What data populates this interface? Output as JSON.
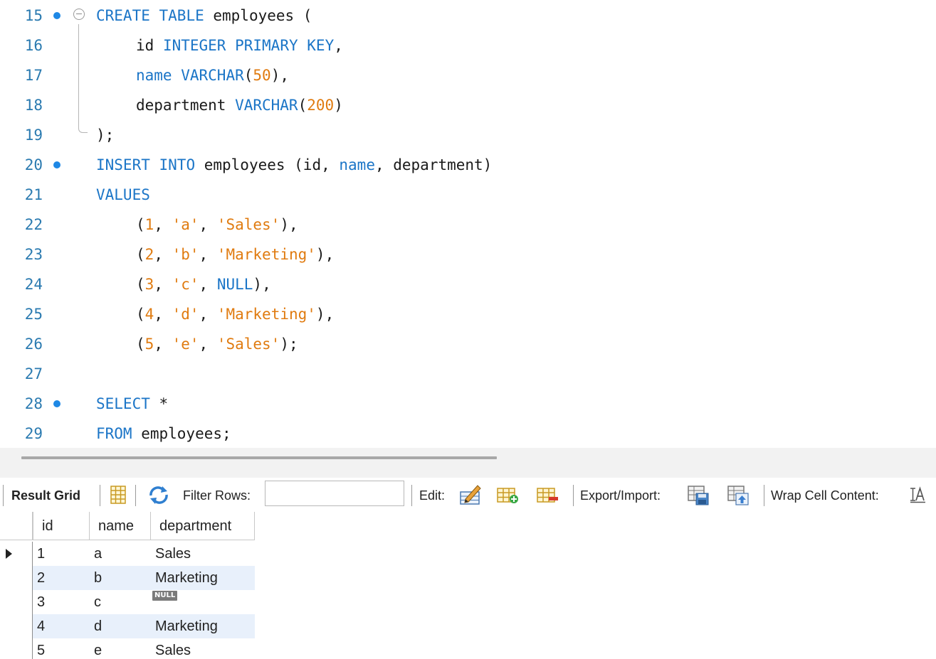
{
  "editor": {
    "lines": [
      {
        "n": "15",
        "marker": true,
        "fold": "open",
        "indent": 0,
        "tokens": [
          {
            "t": "CREATE",
            "c": "kw"
          },
          {
            "t": " ",
            "c": "pl"
          },
          {
            "t": "TABLE",
            "c": "kw"
          },
          {
            "t": " employees (",
            "c": "pl"
          }
        ]
      },
      {
        "n": "16",
        "marker": false,
        "indent": 1,
        "tokens": [
          {
            "t": "id ",
            "c": "pl"
          },
          {
            "t": "INTEGER",
            "c": "kw"
          },
          {
            "t": " ",
            "c": "pl"
          },
          {
            "t": "PRIMARY",
            "c": "kw"
          },
          {
            "t": " ",
            "c": "pl"
          },
          {
            "t": "KEY",
            "c": "kw"
          },
          {
            "t": ",",
            "c": "pl"
          }
        ]
      },
      {
        "n": "17",
        "marker": false,
        "indent": 1,
        "tokens": [
          {
            "t": "name",
            "c": "kw"
          },
          {
            "t": " ",
            "c": "pl"
          },
          {
            "t": "VARCHAR",
            "c": "kw"
          },
          {
            "t": "(",
            "c": "pl"
          },
          {
            "t": "50",
            "c": "num"
          },
          {
            "t": "),",
            "c": "pl"
          }
        ]
      },
      {
        "n": "18",
        "marker": false,
        "indent": 1,
        "tokens": [
          {
            "t": "department ",
            "c": "pl"
          },
          {
            "t": "VARCHAR",
            "c": "kw"
          },
          {
            "t": "(",
            "c": "pl"
          },
          {
            "t": "200",
            "c": "num"
          },
          {
            "t": ")",
            "c": "pl"
          }
        ]
      },
      {
        "n": "19",
        "marker": false,
        "indent": 0,
        "tokens": [
          {
            "t": ");",
            "c": "pl"
          }
        ]
      },
      {
        "n": "20",
        "marker": true,
        "indent": 0,
        "tokens": [
          {
            "t": "INSERT",
            "c": "kw"
          },
          {
            "t": " ",
            "c": "pl"
          },
          {
            "t": "INTO",
            "c": "kw"
          },
          {
            "t": " employees (id, ",
            "c": "pl"
          },
          {
            "t": "name",
            "c": "kw"
          },
          {
            "t": ", department)",
            "c": "pl"
          }
        ]
      },
      {
        "n": "21",
        "marker": false,
        "indent": 0,
        "tokens": [
          {
            "t": "VALUES",
            "c": "kw"
          }
        ]
      },
      {
        "n": "22",
        "marker": false,
        "indent": 1,
        "tokens": [
          {
            "t": "(",
            "c": "pl"
          },
          {
            "t": "1",
            "c": "num"
          },
          {
            "t": ", ",
            "c": "pl"
          },
          {
            "t": "'a'",
            "c": "str"
          },
          {
            "t": ", ",
            "c": "pl"
          },
          {
            "t": "'Sales'",
            "c": "str"
          },
          {
            "t": "),",
            "c": "pl"
          }
        ]
      },
      {
        "n": "23",
        "marker": false,
        "indent": 1,
        "tokens": [
          {
            "t": "(",
            "c": "pl"
          },
          {
            "t": "2",
            "c": "num"
          },
          {
            "t": ", ",
            "c": "pl"
          },
          {
            "t": "'b'",
            "c": "str"
          },
          {
            "t": ", ",
            "c": "pl"
          },
          {
            "t": "'Marketing'",
            "c": "str"
          },
          {
            "t": "),",
            "c": "pl"
          }
        ]
      },
      {
        "n": "24",
        "marker": false,
        "indent": 1,
        "tokens": [
          {
            "t": "(",
            "c": "pl"
          },
          {
            "t": "3",
            "c": "num"
          },
          {
            "t": ", ",
            "c": "pl"
          },
          {
            "t": "'c'",
            "c": "str"
          },
          {
            "t": ", ",
            "c": "pl"
          },
          {
            "t": "NULL",
            "c": "kw"
          },
          {
            "t": "),",
            "c": "pl"
          }
        ]
      },
      {
        "n": "25",
        "marker": false,
        "indent": 1,
        "tokens": [
          {
            "t": "(",
            "c": "pl"
          },
          {
            "t": "4",
            "c": "num"
          },
          {
            "t": ", ",
            "c": "pl"
          },
          {
            "t": "'d'",
            "c": "str"
          },
          {
            "t": ", ",
            "c": "pl"
          },
          {
            "t": "'Marketing'",
            "c": "str"
          },
          {
            "t": "),",
            "c": "pl"
          }
        ]
      },
      {
        "n": "26",
        "marker": false,
        "indent": 1,
        "tokens": [
          {
            "t": "(",
            "c": "pl"
          },
          {
            "t": "5",
            "c": "num"
          },
          {
            "t": ", ",
            "c": "pl"
          },
          {
            "t": "'e'",
            "c": "str"
          },
          {
            "t": ", ",
            "c": "pl"
          },
          {
            "t": "'Sales'",
            "c": "str"
          },
          {
            "t": ");",
            "c": "pl"
          }
        ]
      },
      {
        "n": "27",
        "marker": false,
        "indent": 0,
        "tokens": []
      },
      {
        "n": "28",
        "marker": true,
        "indent": 0,
        "tokens": [
          {
            "t": "SELECT",
            "c": "kw"
          },
          {
            "t": " *",
            "c": "pl"
          }
        ]
      },
      {
        "n": "29",
        "marker": false,
        "indent": 0,
        "tokens": [
          {
            "t": "FROM",
            "c": "kw"
          },
          {
            "t": " employees;",
            "c": "pl"
          }
        ]
      }
    ]
  },
  "toolbar": {
    "result_grid_label": "Result Grid",
    "filter_label": "Filter Rows:",
    "filter_value": "",
    "edit_label": "Edit:",
    "export_label": "Export/Import:",
    "wrap_label": "Wrap Cell Content:",
    "icons": [
      "grid-view-icon",
      "refresh-icon",
      "edit-cell-icon",
      "add-row-icon",
      "delete-row-icon",
      "export-icon",
      "import-icon",
      "wrap-text-icon"
    ]
  },
  "grid": {
    "columns": [
      "id",
      "name",
      "department"
    ],
    "rows": [
      {
        "id": "1",
        "name": "a",
        "department": "Sales",
        "null": false
      },
      {
        "id": "2",
        "name": "b",
        "department": "Marketing",
        "null": false
      },
      {
        "id": "3",
        "name": "c",
        "department": "NULL",
        "null": true
      },
      {
        "id": "4",
        "name": "d",
        "department": "Marketing",
        "null": false
      },
      {
        "id": "5",
        "name": "e",
        "department": "Sales",
        "null": false
      }
    ],
    "selected_row": 0
  },
  "colors": {
    "keyword": "#1b75c7",
    "string": "#e07b10",
    "line_number": "#2a7ab0",
    "marker": "#1e88e5",
    "alt_row": "#e8f0fb"
  }
}
